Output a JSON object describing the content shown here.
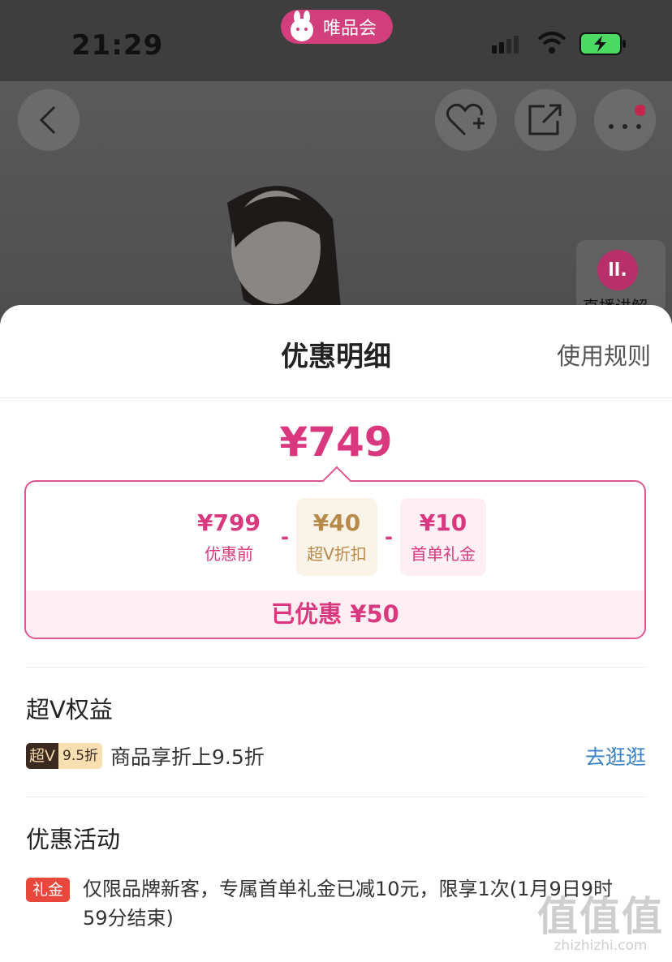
{
  "status_bar": {
    "time": "21:29",
    "app_name": "唯品会"
  },
  "product_top": {
    "live_label": "直播讲解"
  },
  "sheet": {
    "title": "优惠明细",
    "rules_link": "使用规则",
    "final_price": "¥749",
    "breakdown": {
      "original": {
        "amount": "¥799",
        "label": "优惠前"
      },
      "minus_1": "-",
      "svip_discount": {
        "amount": "¥40",
        "label": "超V折扣"
      },
      "minus_2": "-",
      "gift": {
        "amount": "¥10",
        "label": "首单礼金"
      },
      "saved_label": "已优惠 ¥50"
    },
    "svip_section": {
      "title": "超V权益",
      "badge_left": "超V",
      "badge_right": "9.5折",
      "text": "商品享折上9.5折",
      "link": "去逛逛"
    },
    "promo_section": {
      "title": "优惠活动",
      "tag": "礼金",
      "text": "仅限品牌新客，专属首单礼金已减10元，限享1次(1月9日9时59分结束)"
    }
  },
  "watermark": {
    "big": "值值值",
    "small": "zhizhizhi.com"
  },
  "colors": {
    "accent": "#d9387e",
    "svip_gold": "#b88a4a",
    "link_blue": "#3b82c4",
    "gift_red": "#e8483b"
  }
}
